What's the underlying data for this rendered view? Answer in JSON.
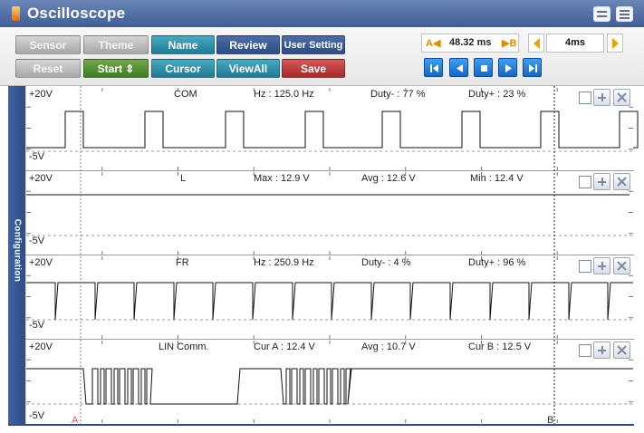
{
  "window": {
    "title": "Oscilloscope"
  },
  "toolbar": {
    "buttons_row1": [
      {
        "label": "Sensor",
        "name": "sensor-button",
        "color": "gray"
      },
      {
        "label": "Theme",
        "name": "theme-button",
        "color": "gray"
      },
      {
        "label": "Name",
        "name": "name-button",
        "color": "teal"
      },
      {
        "label": "Review",
        "name": "review-button",
        "color": "navy"
      },
      {
        "label": "User Setting",
        "name": "user-setting-button",
        "color": "navy"
      }
    ],
    "buttons_row2": [
      {
        "label": "Reset",
        "name": "reset-button",
        "color": "gray"
      },
      {
        "label": "Start ⇕",
        "name": "start-button",
        "color": "green"
      },
      {
        "label": "Cursor",
        "name": "cursor-button",
        "color": "teal"
      },
      {
        "label": "ViewAll",
        "name": "viewall-button",
        "color": "teal"
      },
      {
        "label": "Save",
        "name": "save-button",
        "color": "red"
      }
    ],
    "time_a_label": "A◀",
    "time_value": "48.32 ms",
    "time_b_label": "▶B",
    "scale_value": "4ms"
  },
  "sidebar": {
    "label": "Configuration"
  },
  "channels": [
    {
      "top_label": "+20V",
      "bottom_label": "-5V",
      "name": "COM",
      "m1": "Hz : 125.0 Hz",
      "m2": "Duty- : 77 %",
      "m3": "Duty+ : 23 %"
    },
    {
      "top_label": "+20V",
      "bottom_label": "-5V",
      "name": "L",
      "m1": "Max : 12.9 V",
      "m2": "Avg : 12.6 V",
      "m3": "Min : 12.4 V"
    },
    {
      "top_label": "+20V",
      "bottom_label": "-5V",
      "name": "FR",
      "m1": "Hz : 250.9 Hz",
      "m2": "Duty- : 4 %",
      "m3": "Duty+ : 96 %"
    },
    {
      "top_label": "+20V",
      "bottom_label": "-5V",
      "name": "LIN Comm.",
      "m1": "Cur A : 12.4 V",
      "m2": "Avg : 10.7 V",
      "m3": "Cur B : 12.5 V"
    }
  ],
  "cursors": {
    "a_label": "A",
    "b_label": "B"
  },
  "colors": {
    "title_bar": "#4f6ea6",
    "sidebar": "#2e4d86",
    "cursor_a": "#e05b5b",
    "cursor_b": "#222222"
  }
}
